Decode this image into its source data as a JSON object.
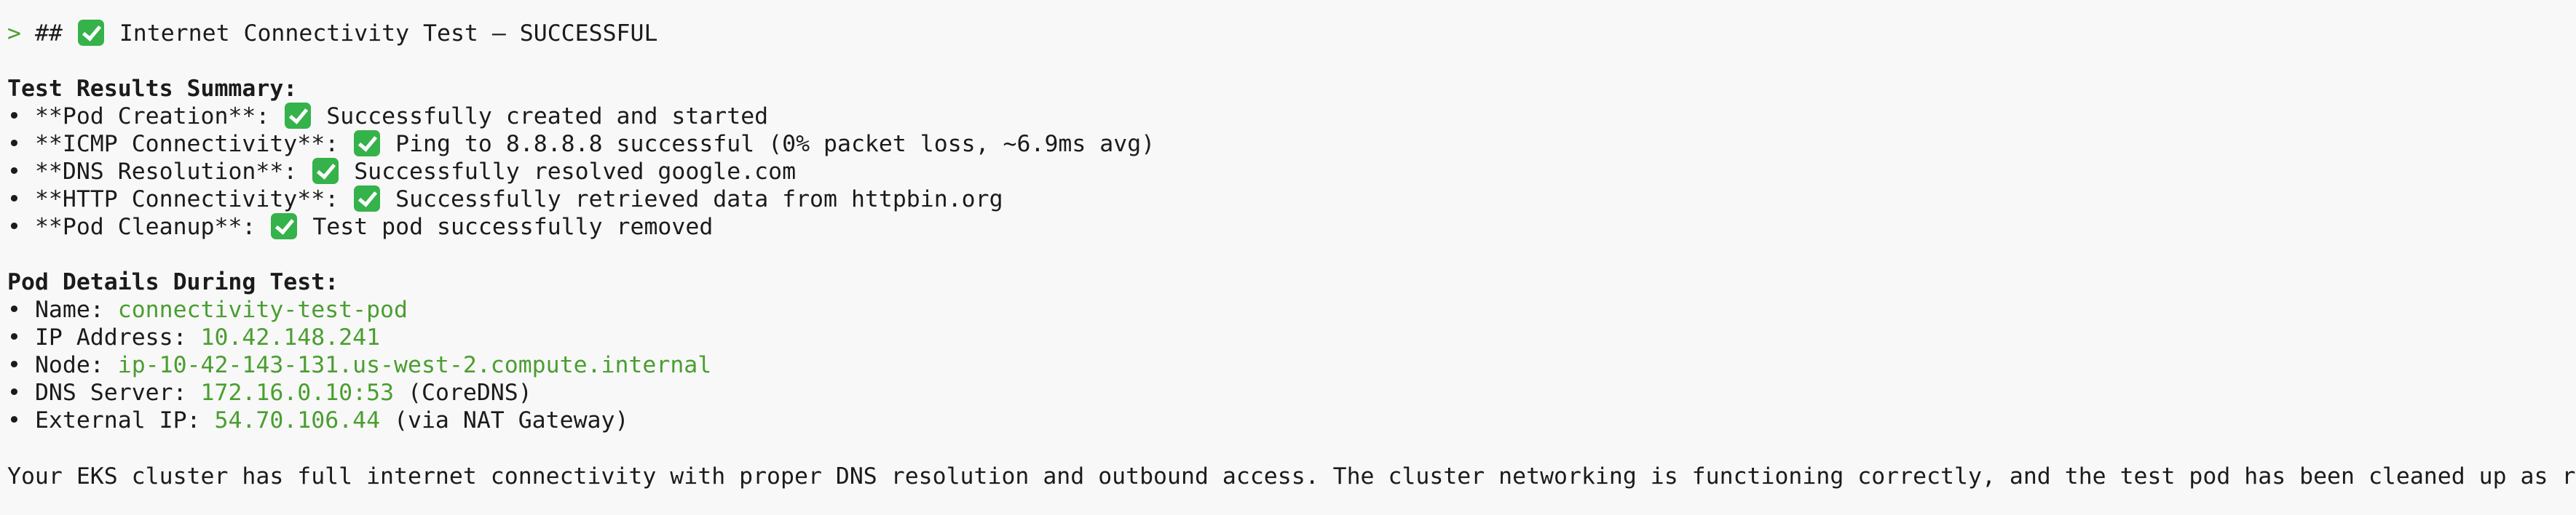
{
  "header": {
    "prompt": ">",
    "hashes": "##",
    "title": "Internet Connectivity Test – SUCCESSFUL",
    "icon": "check-mark-icon"
  },
  "summary": {
    "heading": "Test Results Summary:",
    "bullet": "•",
    "items": [
      {
        "label": "**Pod Creation**:",
        "text": "Successfully created and started"
      },
      {
        "label": "**ICMP Connectivity**:",
        "text": "Ping to 8.8.8.8 successful (0% packet loss, ~6.9ms avg)"
      },
      {
        "label": "**DNS Resolution**:",
        "text": "Successfully resolved google.com"
      },
      {
        "label": "**HTTP Connectivity**:",
        "text": "Successfully retrieved data from httpbin.org"
      },
      {
        "label": "**Pod Cleanup**:",
        "text": "Test pod successfully removed"
      }
    ]
  },
  "pod_details": {
    "heading": "Pod Details During Test:",
    "items": [
      {
        "label": "Name:",
        "value": "connectivity-test-pod",
        "suffix": ""
      },
      {
        "label": "IP Address:",
        "value": "10.42.148.241",
        "suffix": ""
      },
      {
        "label": "Node:",
        "value": "ip-10-42-143-131.us-west-2.compute.internal",
        "suffix": ""
      },
      {
        "label": "DNS Server:",
        "value": "172.16.0.10:53",
        "suffix": "(CoreDNS)"
      },
      {
        "label": "External IP:",
        "value": "54.70.106.44",
        "suffix": "(via NAT Gateway)"
      }
    ]
  },
  "conclusion": "Your EKS cluster has full internet connectivity with proper DNS resolution and outbound access. The cluster networking is functioning correctly, and the test pod has been cleaned up as requested.",
  "colors": {
    "background": "#f8f8f8",
    "text": "#1b1b1b",
    "accent_green": "#4a9e30",
    "check_green": "#35b24a"
  }
}
